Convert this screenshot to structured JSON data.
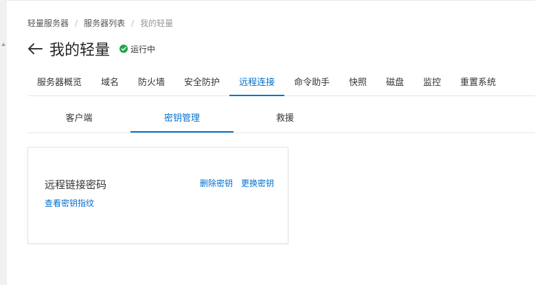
{
  "breadcrumb": {
    "items": [
      "轻量服务器",
      "服务器列表",
      "我的轻量"
    ],
    "separator": "/"
  },
  "header": {
    "title": "我的轻量",
    "status_text": "运行中",
    "status_color": "#21a34a",
    "back_icon": "arrow-left-icon"
  },
  "tabs": [
    "服务器概览",
    "域名",
    "防火墙",
    "安全防护",
    "远程连接",
    "命令助手",
    "快照",
    "磁盘",
    "监控",
    "重置系统"
  ],
  "active_tab": "远程连接",
  "subtabs": [
    "客户端",
    "密钥管理",
    "救援"
  ],
  "active_subtab": "密钥管理",
  "key_card": {
    "title": "远程链接密码",
    "delete_label": "删除密钥",
    "replace_label": "更换密钥",
    "fingerprint_label": "查看密钥指纹"
  },
  "colors": {
    "accent": "#0070cc",
    "status_ok": "#21a34a"
  }
}
